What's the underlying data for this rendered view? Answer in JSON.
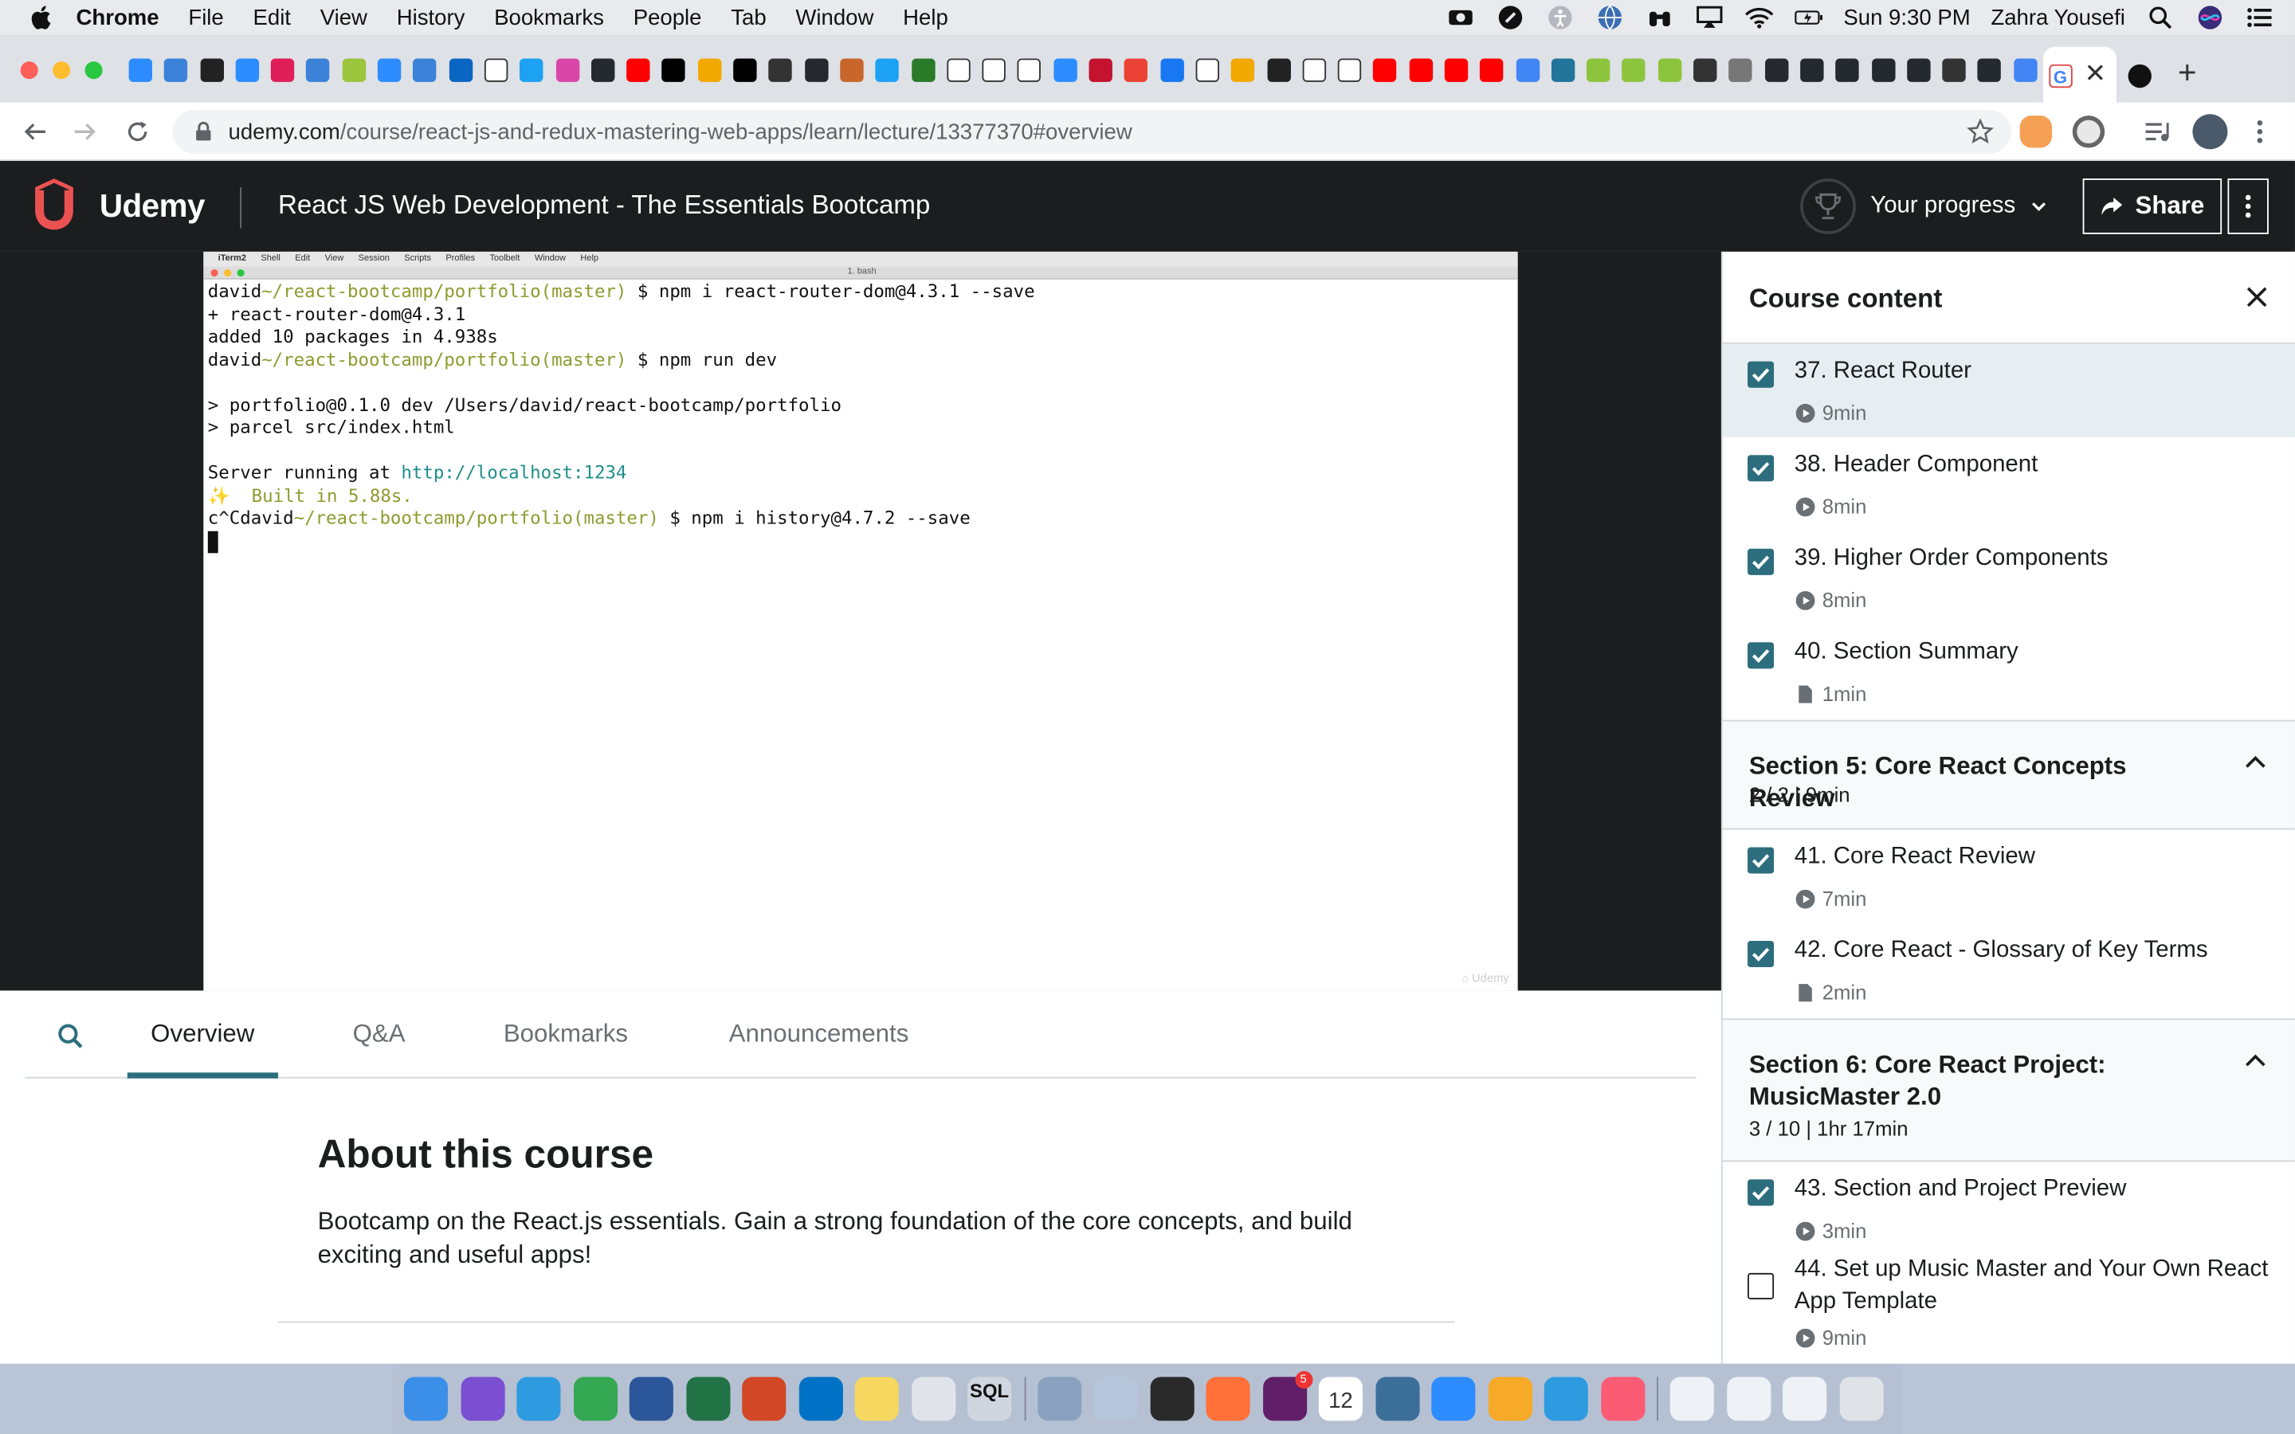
{
  "menubar": {
    "app": "Chrome",
    "items": [
      "File",
      "Edit",
      "View",
      "History",
      "Bookmarks",
      "People",
      "Tab",
      "Window",
      "Help"
    ],
    "clock": "Sun 9:30 PM",
    "user": "Zahra Yousefi"
  },
  "browser": {
    "url_host": "udemy.com",
    "url_path": "/course/react-js-and-redux-mastering-web-apps/learn/lecture/13377370#overview",
    "tab_icons": [
      "zoom-icon",
      "circle-icon",
      "letter-l-icon",
      "zoom-icon",
      "slack-icon",
      "circle-icon",
      "w-icon",
      "zoom-icon",
      "circle-icon",
      "linkedin-icon",
      "amazon-icon",
      "twitter-icon",
      "star-icon",
      "github-icon",
      "youtube-icon",
      "black-square-icon",
      "nbc-icon",
      "black-square-icon",
      "bbc-icon",
      "github-icon",
      "feather-icon",
      "twitter-icon",
      "arabic-icon",
      "amazon-icon",
      "amazon-icon",
      "amazon-icon",
      "zoom-icon",
      "bank-icon",
      "gmail-icon",
      "facebook-icon",
      "hand-icon",
      "nbc-icon",
      "tumblr-icon",
      "hand-icon",
      "hand-icon",
      "youtube-icon",
      "youtube-icon",
      "youtube-icon",
      "youtube-icon",
      "google-icon",
      "wordpress-icon",
      "leaf-icon",
      "leaf-icon",
      "leaf-icon",
      "scissors-icon",
      "globe-icon",
      "github-icon",
      "github-icon",
      "github-icon",
      "github-icon",
      "github-icon",
      "bbc-icon",
      "github-icon",
      "google-icon"
    ],
    "active_tab_icon": "medium-icon"
  },
  "udemy": {
    "logo": "Udemy",
    "course_title": "React JS Web Development - The Essentials Bootcamp",
    "progress_label": "Your progress",
    "share_label": "Share"
  },
  "terminal": {
    "menu": [
      "iTerm2",
      "Shell",
      "Edit",
      "View",
      "Session",
      "Scripts",
      "Profiles",
      "Toolbelt",
      "Window",
      "Help"
    ],
    "window_title": "1. bash",
    "lines": [
      {
        "user": "david",
        "path": "~/react-bootcamp/portfolio(master)",
        "cmd": " $ npm i react-router-dom@4.3.1 --save"
      },
      {
        "text": "+ react-router-dom@4.3.1"
      },
      {
        "text": "added 10 packages in 4.938s"
      },
      {
        "user": "david",
        "path": "~/react-bootcamp/portfolio(master)",
        "cmd": " $ npm run dev"
      },
      {
        "text": ""
      },
      {
        "text": "> portfolio@0.1.0 dev /Users/david/react-bootcamp/portfolio"
      },
      {
        "text": "> parcel src/index.html"
      },
      {
        "text": ""
      },
      {
        "text": "Server running at ",
        "link": "http://localhost:1234"
      },
      {
        "built": "✨  Built in 5.88s."
      },
      {
        "user": "c^Cdavid",
        "path": "~/react-bootcamp/portfolio(master)",
        "cmd": " $ npm i history@4.7.2 --save"
      }
    ]
  },
  "tabs": [
    "Overview",
    "Q&A",
    "Bookmarks",
    "Announcements"
  ],
  "overview": {
    "heading": "About this course",
    "description": "Bootcamp on the React.js essentials. Gain a strong foundation of the core concepts, and build exciting and useful apps!"
  },
  "sidebar": {
    "title": "Course content",
    "lectures_top": [
      {
        "title": "37. React Router",
        "duration": "9min",
        "kind": "video",
        "checked": true,
        "current": true
      },
      {
        "title": "38. Header Component",
        "duration": "8min",
        "kind": "video",
        "checked": true
      },
      {
        "title": "39. Higher Order Components",
        "duration": "8min",
        "kind": "video",
        "checked": true
      },
      {
        "title": "40. Section Summary",
        "duration": "1min",
        "kind": "article",
        "checked": true
      }
    ],
    "section5": {
      "title": "Section 5: Core React Concepts Review",
      "summary": "2 / 2 | 9min"
    },
    "lectures_s5": [
      {
        "title": "41. Core React Review",
        "duration": "7min",
        "kind": "video",
        "checked": true
      },
      {
        "title": "42. Core React - Glossary of Key Terms",
        "duration": "2min",
        "kind": "article",
        "checked": true
      }
    ],
    "section6": {
      "title": "Section 6: Core React Project: MusicMaster 2.0",
      "summary": "3 / 10 | 1hr 17min"
    },
    "lectures_s6": [
      {
        "title": "43. Section and Project Preview",
        "duration": "3min",
        "kind": "video",
        "checked": true
      },
      {
        "title": "44. Set up Music Master and Your Own React App Template",
        "duration": "9min",
        "kind": "video",
        "checked": false
      }
    ]
  },
  "dock": {
    "apps": [
      "finder-icon",
      "siri-icon",
      "safari-icon",
      "chrome-icon",
      "word-icon",
      "excel-icon",
      "powerpoint-icon",
      "outlook-icon",
      "notes-icon",
      "launchpad-icon",
      "sql-icon",
      "database-icon",
      "preview-icon",
      "terminal-icon",
      "firefox-icon",
      "slack-icon",
      "calendar-icon",
      "mysql-icon",
      "zoom-icon",
      "sketch-icon",
      "safari-icon",
      "itunes-icon",
      "window-icon",
      "window-icon",
      "window-icon",
      "trash-icon"
    ],
    "calendar_date": "12",
    "slack_badge": "5"
  }
}
